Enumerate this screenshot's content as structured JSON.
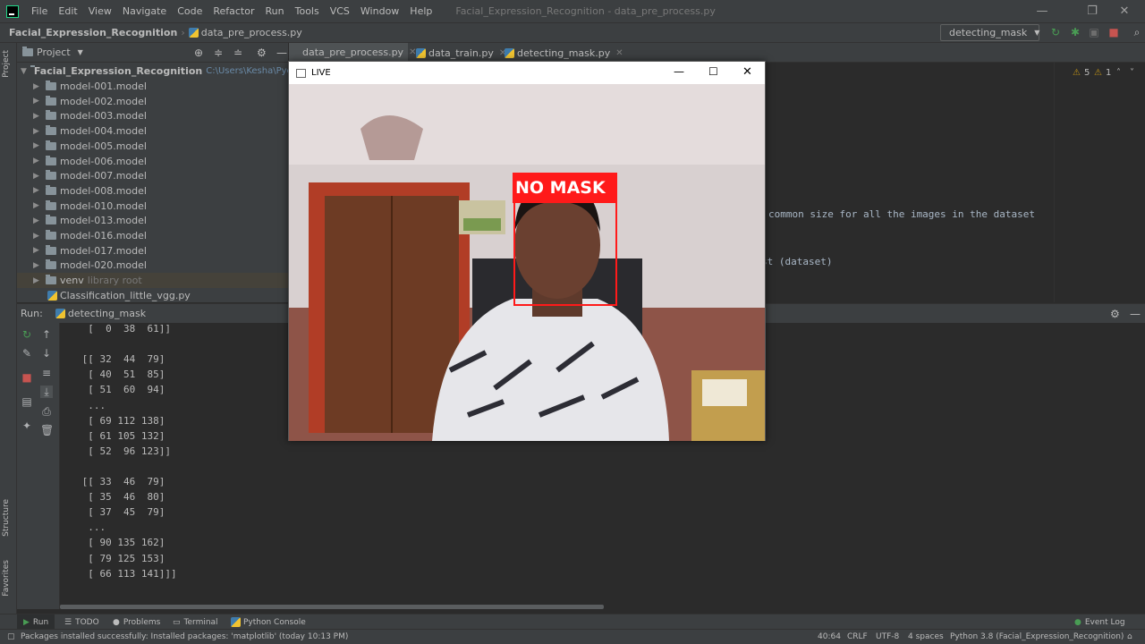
{
  "titlebar": {
    "menu": [
      "File",
      "Edit",
      "View",
      "Navigate",
      "Code",
      "Refactor",
      "Run",
      "Tools",
      "VCS",
      "Window",
      "Help"
    ],
    "window_title": "Facial_Expression_Recognition - data_pre_process.py",
    "minimize": "—",
    "restore": "❐",
    "close": "✕"
  },
  "navbar": {
    "project": "Facial_Expression_Recognition",
    "separator": "›",
    "file": "data_pre_process.py",
    "run_config": "detecting_mask"
  },
  "stripe": {
    "project": "Project",
    "structure": "Structure",
    "favorites": "Favorites"
  },
  "project_panel": {
    "title": "Project",
    "root": "Facial_Expression_Recognition",
    "root_path": "C:\\Users\\Kesha\\PycharmProj",
    "items": [
      "model-001.model",
      "model-002.model",
      "model-003.model",
      "model-004.model",
      "model-005.model",
      "model-006.model",
      "model-007.model",
      "model-008.model",
      "model-010.model",
      "model-013.model",
      "model-016.model",
      "model-017.model",
      "model-020.model"
    ],
    "venv": "venv",
    "venv_note": "library root",
    "file": "Classification_little_vgg.py"
  },
  "editor": {
    "tabs": [
      "data_pre_process.py",
      "data_train.py",
      "detecting_mask.py"
    ],
    "warnings": "5",
    "weak_warnings": "1",
    "code_line_1": "common size for all the images in the dataset",
    "code_line_2": "st (dataset)"
  },
  "run_panel": {
    "label": "Run:",
    "tab": "detecting_mask",
    "console_lines": [
      "  [  0  38  61]]",
      "",
      " [[ 32  44  79]",
      "  [ 40  51  85]",
      "  [ 51  60  94]",
      "  ...",
      "  [ 69 112 138]",
      "  [ 61 105 132]",
      "  [ 52  96 123]]",
      "",
      " [[ 33  46  79]",
      "  [ 35  46  80]",
      "  [ 37  45  79]",
      "  ...",
      "  [ 90 135 162]",
      "  [ 79 125 153]",
      "  [ 66 113 141]]]"
    ]
  },
  "bottom_tabs": {
    "run": "Run",
    "todo": "TODO",
    "problems": "Problems",
    "terminal": "Terminal",
    "python_console": "Python Console",
    "event_log": "Event Log"
  },
  "status": {
    "message": "Packages installed successfully: Installed packages: 'matplotlib' (today 10:13 PM)",
    "position": "40:64",
    "line_sep": "CRLF",
    "encoding": "UTF-8",
    "indent": "4 spaces",
    "interpreter": "Python 3.8 (Facial_Expression_Recognition)"
  },
  "live_window": {
    "title": "LIVE",
    "detection_label": "NO MASK",
    "detection_color": "#ff1a1a"
  },
  "colors": {
    "ide_bg": "#2b2b2b",
    "panel_bg": "#3c3f41",
    "run_green": "#499c54",
    "stop_red": "#c75450"
  }
}
